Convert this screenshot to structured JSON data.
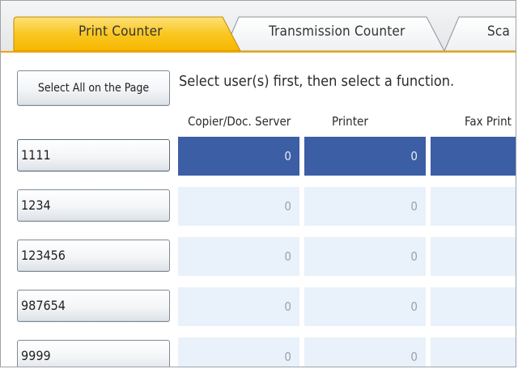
{
  "tabs": [
    {
      "label": "Print Counter",
      "active": true
    },
    {
      "label": "Transmission Counter",
      "active": false
    },
    {
      "label": "Sca",
      "active": false
    }
  ],
  "select_all_label": "Select All on the Page",
  "instruction": "Select user(s) first, then select a function.",
  "columns": [
    "Copier/Doc. Server",
    "Printer",
    "Fax Print"
  ],
  "rows": [
    {
      "user": "1111",
      "values": [
        "0",
        "0",
        ""
      ],
      "selected": true
    },
    {
      "user": "1234",
      "values": [
        "0",
        "0",
        ""
      ],
      "selected": false
    },
    {
      "user": "123456",
      "values": [
        "0",
        "0",
        ""
      ],
      "selected": false
    },
    {
      "user": "987654",
      "values": [
        "0",
        "0",
        ""
      ],
      "selected": false
    },
    {
      "user": "9999",
      "values": [
        "0",
        "0",
        ""
      ],
      "selected": false
    }
  ],
  "colors": {
    "active_tab": "#f9c21f",
    "tab_border": "#f2a300",
    "selected_row": "#3c5ea5",
    "cell_bg": "#e9f1fa"
  }
}
